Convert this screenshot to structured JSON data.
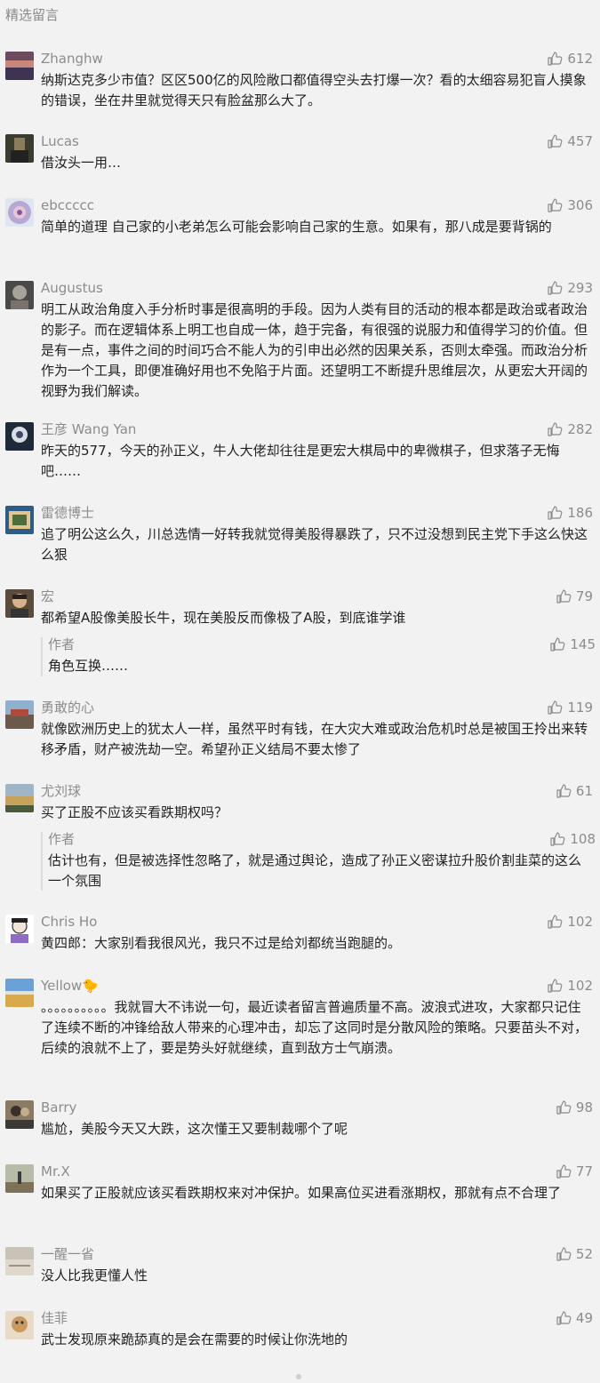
{
  "section_title": "精选留言",
  "comments": [
    {
      "nick": "Zhanghw",
      "likes": "612",
      "text": "纳斯达克多少市值？区区500亿的风险敞口都值得空头去打爆一次？看的太细容易犯盲人摸象的错误，坐在井里就觉得天只有脸盆那么大了。"
    },
    {
      "nick": "Lucas",
      "likes": "457",
      "text": "借汝头一用…"
    },
    {
      "nick": "ebccccc",
      "likes": "306",
      "text": "简单的道理 自己家的小老弟怎么可能会影响自己家的生意。如果有，那八成是要背锅的"
    },
    {
      "nick": "Augustus",
      "likes": "293",
      "text": "明工从政治角度入手分析时事是很高明的手段。因为人类有目的活动的根本都是政治或者政治的影子。而在逻辑体系上明工也自成一体，趋于完备，有很强的说服力和值得学习的价值。但是有一点，事件之间的时间巧合不能人为的引申出必然的因果关系，否则太牵强。而政治分析作为一个工具，即便准确好用也不免陷于片面。还望明工不断提升思维层次，从更宏大开阔的视野为我们解读。"
    },
    {
      "nick": "王彦 Wang Yan",
      "likes": "282",
      "text": "昨天的577，今天的孙正义，牛人大佬却往往是更宏大棋局中的卑微棋子，但求落子无悔吧……"
    },
    {
      "nick": "雷德博士",
      "likes": "186",
      "text": "追了明公这么久，川总选情一好转我就觉得美股得暴跌了，只不过没想到民主党下手这么快这么狠"
    },
    {
      "nick": "宏",
      "likes": "79",
      "text": "都希望A股像美股长牛，现在美股反而像极了A股，到底谁学谁",
      "reply": {
        "name": "作者",
        "likes": "145",
        "text": "角色互换……"
      }
    },
    {
      "nick": "勇敢的心",
      "likes": "119",
      "text": "就像欧洲历史上的犹太人一样，虽然平时有钱，在大灾大难或政治危机时总是被国王拎出来转移矛盾，财产被洗劫一空。希望孙正义结局不要太惨了"
    },
    {
      "nick": "尤刘球",
      "likes": "61",
      "text": "买了正股不应该买看跌期权吗？",
      "reply": {
        "name": "作者",
        "likes": "108",
        "text": "估计也有，但是被选择性忽略了，就是通过舆论，造成了孙正义密谋拉升股价割韭菜的这么一个氛围"
      }
    },
    {
      "nick": "Chris Ho",
      "likes": "102",
      "text": "黄四郎：大家别看我很风光，我只不过是给刘都统当跑腿的。"
    },
    {
      "nick": "Yellow🐤",
      "likes": "102",
      "text": "。。。。。。。。。。我就冒大不讳说一句，最近读者留言普遍质量不高。波浪式进攻，大家都只记住了连续不断的冲锋给敌人带来的心理冲击，却忘了这同时是分散风险的策略。只要苗头不对，后续的浪就不上了，要是势头好就继续，直到敌方士气崩溃。"
    },
    {
      "nick": "Barry",
      "likes": "98",
      "text": "尴尬，美股今天又大跌，这次懂王又要制裁哪个了呢"
    },
    {
      "nick": "Mr.X",
      "likes": "77",
      "text": "如果买了正股就应该买看跌期权来对冲保护。如果高位买进看涨期权，那就有点不合理了"
    },
    {
      "nick": "一醒一省",
      "likes": "52",
      "text": "没人比我更懂人性"
    },
    {
      "nick": "佳菲",
      "likes": "49",
      "text": "武士发现原来跪舔真的是会在需要的时候让你洗地的"
    }
  ],
  "icons": {
    "like": "thumbs-up-icon"
  }
}
